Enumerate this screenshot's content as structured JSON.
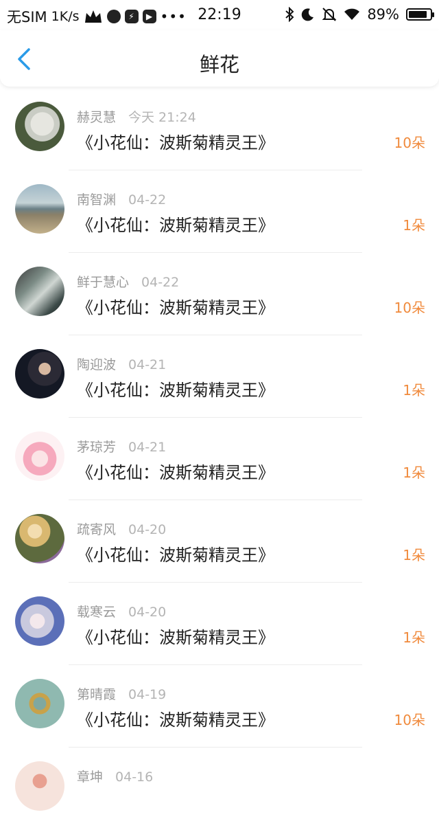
{
  "status_bar": {
    "carrier": "无SIM",
    "speed": "1K/s",
    "time": "22:19",
    "battery": "89%",
    "battery_level": 0.89,
    "icons": [
      "crown-icon",
      "browser-icon",
      "flash-app-icon",
      "video-app-icon",
      "more-dots-icon",
      "bluetooth-icon",
      "moon-icon",
      "mute-icon",
      "wifi-icon",
      "battery-icon"
    ]
  },
  "nav": {
    "back_icon": "chevron-left-icon",
    "title": "鲜花",
    "accent": "#2a9be8"
  },
  "colors": {
    "count": "#f08a3c",
    "name": "#9a9a9a",
    "date": "#b4b4b4"
  },
  "records": [
    {
      "name": "赫灵慧",
      "date": "今天 21:24",
      "gift": "《小花仙：波斯菊精灵王》",
      "count": "10朵"
    },
    {
      "name": "南智渊",
      "date": "04-22",
      "gift": "《小花仙：波斯菊精灵王》",
      "count": "1朵"
    },
    {
      "name": "鲜于慧心",
      "date": "04-22",
      "gift": "《小花仙：波斯菊精灵王》",
      "count": "10朵"
    },
    {
      "name": "陶迎波",
      "date": "04-21",
      "gift": "《小花仙：波斯菊精灵王》",
      "count": "1朵"
    },
    {
      "name": "茅琼芳",
      "date": "04-21",
      "gift": "《小花仙：波斯菊精灵王》",
      "count": "1朵"
    },
    {
      "name": "疏寄风",
      "date": "04-20",
      "gift": "《小花仙：波斯菊精灵王》",
      "count": "1朵"
    },
    {
      "name": "载寒云",
      "date": "04-20",
      "gift": "《小花仙：波斯菊精灵王》",
      "count": "1朵"
    },
    {
      "name": "第晴霞",
      "date": "04-19",
      "gift": "《小花仙：波斯菊精灵王》",
      "count": "10朵"
    },
    {
      "name": "章坤",
      "date": "04-16",
      "gift": "",
      "count": ""
    }
  ]
}
